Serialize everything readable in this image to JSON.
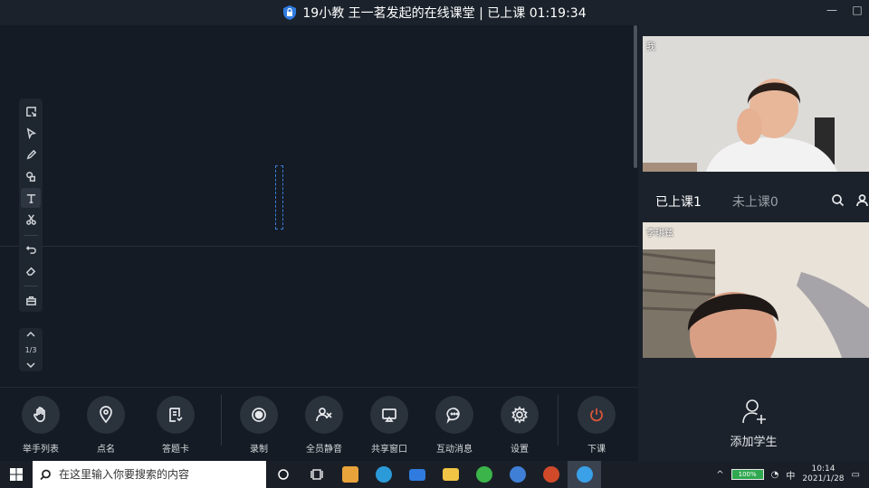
{
  "window": {
    "title": "19小教  王一茗发起的在线课堂 | 已上课 01:19:34",
    "minimize": "—",
    "maximize": "□"
  },
  "board": {
    "page_indicator": "1/3"
  },
  "controls": [
    {
      "id": "raise-hand",
      "label": "举手列表"
    },
    {
      "id": "roll-call",
      "label": "点名"
    },
    {
      "id": "answer-card",
      "label": "答题卡"
    },
    {
      "id": "record",
      "label": "录制"
    },
    {
      "id": "mute-all",
      "label": "全员静音"
    },
    {
      "id": "share-window",
      "label": "共享窗口"
    },
    {
      "id": "messages",
      "label": "互动消息"
    },
    {
      "id": "settings",
      "label": "设置"
    },
    {
      "id": "end-class",
      "label": "下课"
    }
  ],
  "sidebar": {
    "self_label": "我",
    "tab_in_class": "已上课1",
    "tab_not_in_class": "未上课0",
    "student_name": "李琪铉",
    "add_student": "添加学生"
  },
  "taskbar": {
    "search_placeholder": "在这里输入你要搜索的内容",
    "battery": "100%",
    "ime": "中",
    "time": "10:14",
    "date": "2021/1/28"
  },
  "colors": {
    "accent": "#3b7dd8",
    "end_class": "#e0573a"
  }
}
